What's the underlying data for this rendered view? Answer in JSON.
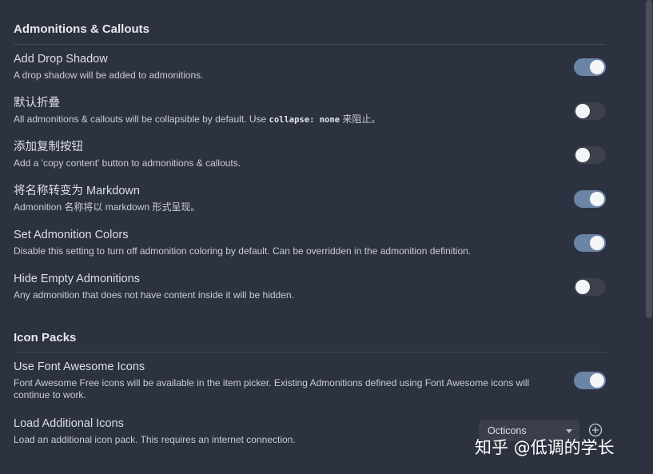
{
  "sections": [
    {
      "title": "Admonitions & Callouts",
      "settings": [
        {
          "name": "Add Drop Shadow",
          "desc": "A drop shadow will be added to admonitions.",
          "toggle": true
        },
        {
          "name": "默认折叠",
          "desc_pre": "All admonitions & callouts will be collapsible by default. Use ",
          "desc_code": "collapse: none",
          "desc_post": " 来阻止。",
          "toggle": false
        },
        {
          "name": "添加复制按钮",
          "desc": "Add a 'copy content' button to admonitions & callouts.",
          "toggle": false
        },
        {
          "name": "将名称转变为 Markdown",
          "desc": "Admonition 名称将以 markdown 形式呈现。",
          "toggle": true
        },
        {
          "name": "Set Admonition Colors",
          "desc": "Disable this setting to turn off admonition coloring by default. Can be overridden in the admonition definition.",
          "toggle": true
        },
        {
          "name": "Hide Empty Admonitions",
          "desc": "Any admonition that does not have content inside it will be hidden.",
          "toggle": false
        }
      ]
    },
    {
      "title": "Icon Packs",
      "settings": [
        {
          "name": "Use Font Awesome Icons",
          "desc": "Font Awesome Free icons will be available in the item picker. Existing Admonitions defined using Font Awesome icons will continue to work.",
          "toggle": true
        },
        {
          "name": "Load Additional Icons",
          "desc": "Load an additional icon pack. This requires an internet connection.",
          "select_value": "Octicons",
          "add_icon": "plus-circle-icon"
        }
      ]
    }
  ],
  "watermark": "知乎 @低调的学长",
  "colors": {
    "background": "#2d3240",
    "toggle_on": "#6b85a6",
    "toggle_off": "#3c414d"
  }
}
